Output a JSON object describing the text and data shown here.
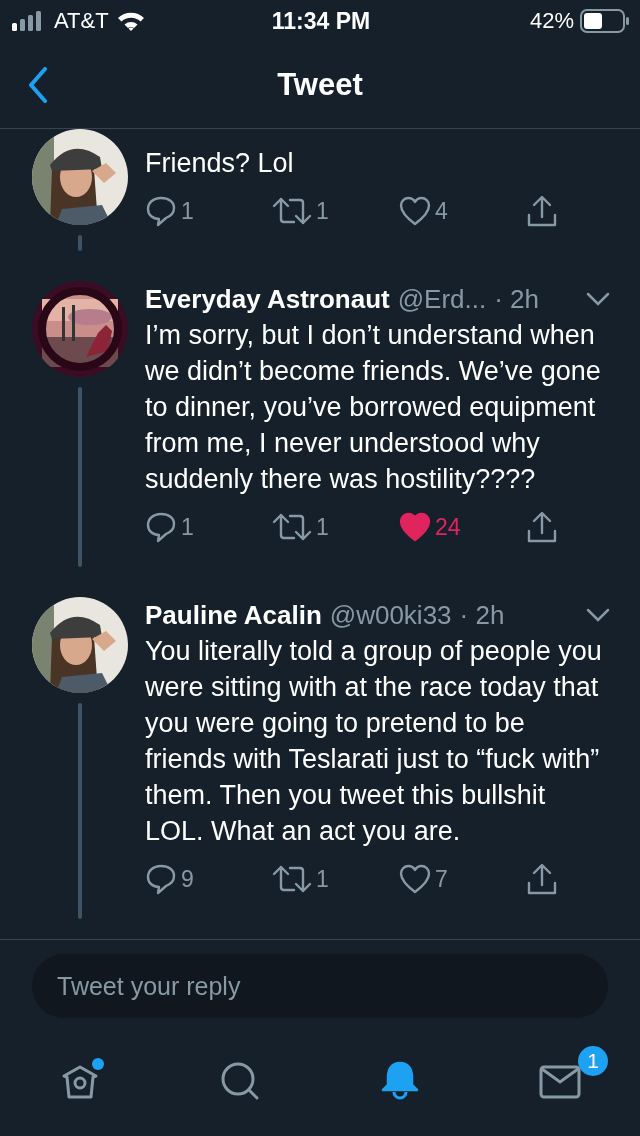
{
  "status_bar": {
    "carrier": "AT&T",
    "time": "11:34 PM",
    "battery": "42%"
  },
  "header": {
    "title": "Tweet"
  },
  "tweets": [
    {
      "text": "Friends? Lol",
      "replies": "1",
      "retweets": "1",
      "likes": "4",
      "liked": false
    },
    {
      "name": "Everyday Astronaut",
      "handle": "@Erd...",
      "time": "· 2h",
      "text": "I’m sorry, but I don’t understand when we didn’t become friends. We’ve gone to dinner, you’ve borrowed equipment from me, I never understood why suddenly there was hostility????",
      "replies": "1",
      "retweets": "1",
      "likes": "24",
      "liked": true
    },
    {
      "name": "Pauline Acalin",
      "handle": "@w00ki33",
      "time": "· 2h",
      "text": "You literally told a group of people you were sitting with at the race today that you were going to pretend to be friends with Teslarati just to “fuck with” them. Then you tweet this bullshit LOL. What an act you are.",
      "replies": "9",
      "retweets": "1",
      "likes": "7",
      "liked": false
    }
  ],
  "reply": {
    "placeholder": "Tweet your reply"
  },
  "tabs": [
    {
      "kind": "home",
      "selected": false,
      "dot": true
    },
    {
      "kind": "search",
      "selected": false,
      "dot": false
    },
    {
      "kind": "bell",
      "selected": true,
      "dot": false
    },
    {
      "kind": "mail",
      "selected": false,
      "dot": false,
      "badge": "1"
    }
  ]
}
